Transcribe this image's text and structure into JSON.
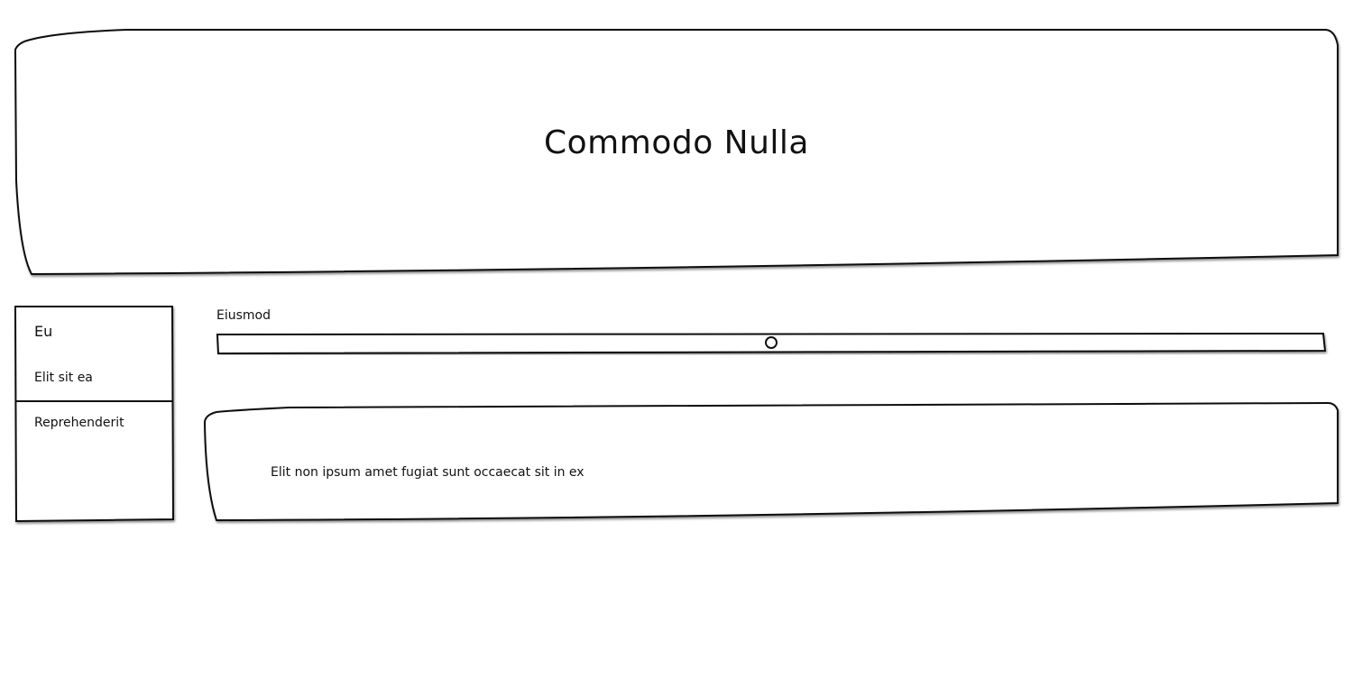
{
  "header": {
    "title": "Commodo Nulla"
  },
  "sidebar": {
    "heading": "Eu",
    "subheading": "Elit sit ea",
    "items": [
      {
        "label": "Reprehenderit"
      }
    ]
  },
  "slider": {
    "label": "Eiusmod",
    "value": 0.5
  },
  "card": {
    "text": "Elit non ipsum amet fugiat sunt occaecat sit in ex"
  }
}
